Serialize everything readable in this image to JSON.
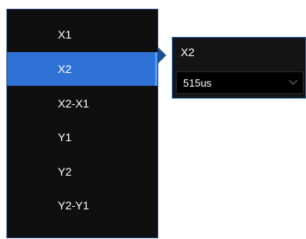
{
  "menu": {
    "items": [
      {
        "label": "X1",
        "active": false
      },
      {
        "label": "X2",
        "active": true
      },
      {
        "label": "X2-X1",
        "active": false
      },
      {
        "label": "Y1",
        "active": false
      },
      {
        "label": "Y2",
        "active": false
      },
      {
        "label": "Y2-Y1",
        "active": false
      }
    ]
  },
  "popup": {
    "title": "X2",
    "value": "515us",
    "dropdown_icon": "chevron-down-icon"
  },
  "colors": {
    "menu_bg": "#0f0f0f",
    "active_bg": "#2f72d6",
    "border_accent": "#2a63b3",
    "text": "#ffffff"
  }
}
